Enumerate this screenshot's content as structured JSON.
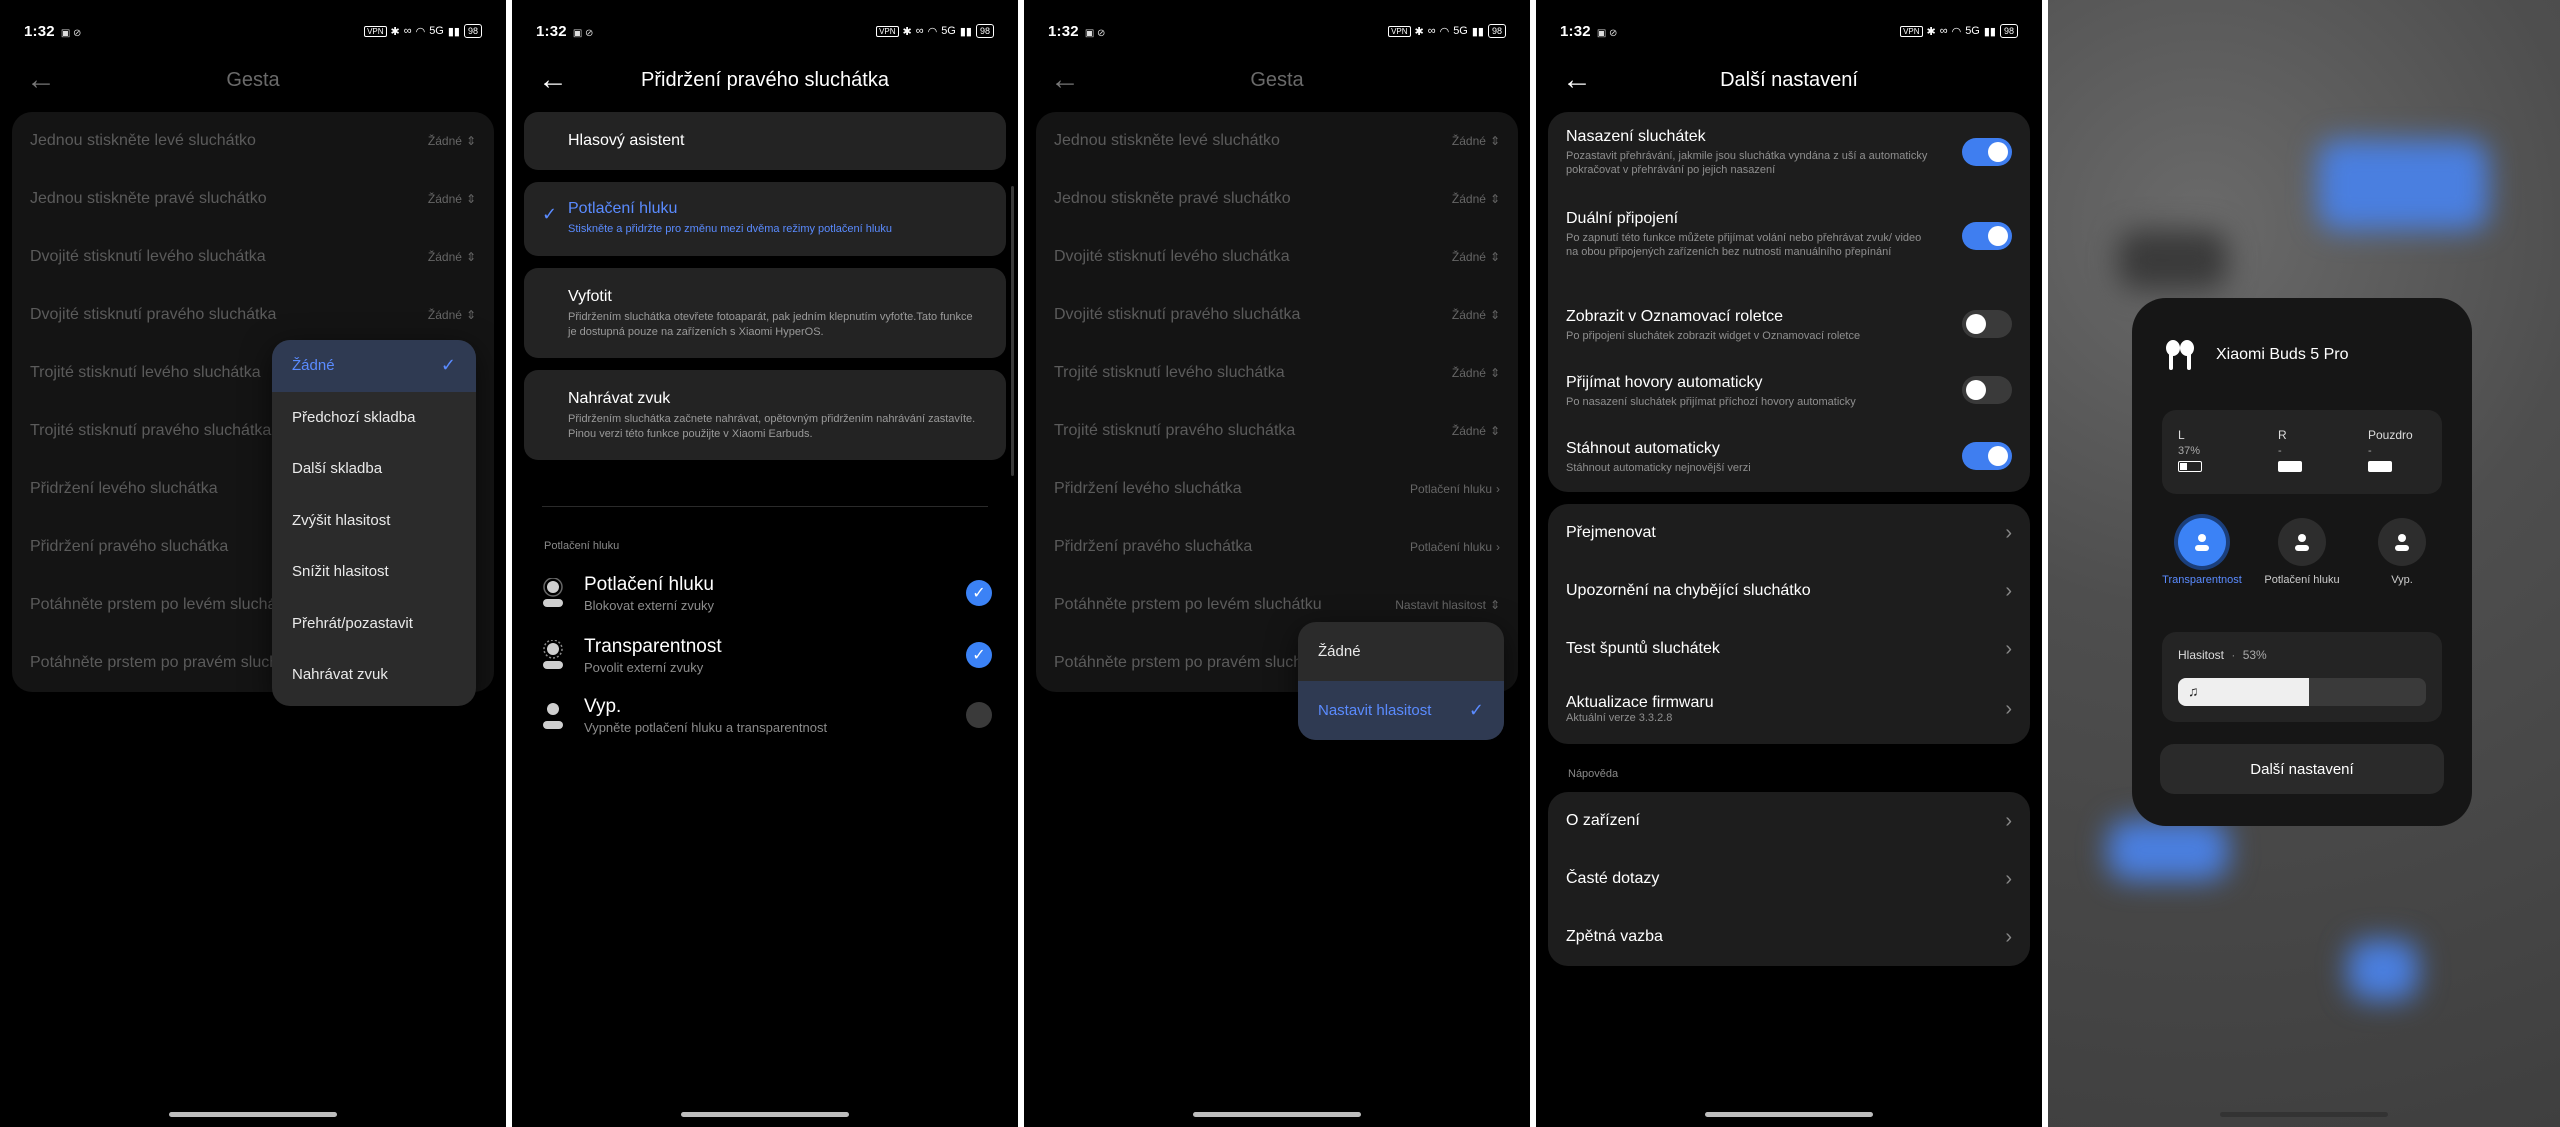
{
  "status": {
    "time": "1:32",
    "battery": "98",
    "vpn": "VPN",
    "network": "5G",
    "network_small": "5G"
  },
  "screen1": {
    "title": "Gesta",
    "rows": [
      {
        "label": "Jednou stiskněte levé sluchátko",
        "value": "Žádné"
      },
      {
        "label": "Jednou stiskněte pravé sluchátko",
        "value": "Žádné"
      },
      {
        "label": "Dvojité stisknutí levého sluchátka",
        "value": "Žádné"
      },
      {
        "label": "Dvojité stisknutí pravého sluchátka",
        "value": "Žádné"
      },
      {
        "label": "Trojité stisknutí levého sluchátka",
        "value": ""
      },
      {
        "label": "Trojité stisknutí pravého sluchátka",
        "value": ""
      },
      {
        "label": "Přidržení levého sluchátka",
        "value": ""
      },
      {
        "label": "Přidržení pravého sluchátka",
        "value": ""
      },
      {
        "label": "Potáhněte prstem po levém sluchátku",
        "value": ""
      },
      {
        "label": "Potáhněte prstem po pravém sluchátku",
        "value": ""
      }
    ],
    "dropdown": [
      "Žádné",
      "Předchozí skladba",
      "Další skladba",
      "Zvýšit hlasitost",
      "Snížit hlasitost",
      "Přehrát/pozastavit",
      "Nahrávat zvuk"
    ],
    "dropdown_selected": 0
  },
  "screen2": {
    "title": "Přidržení pravého sluchátka",
    "options": [
      {
        "title": "Hlasový asistent",
        "desc": ""
      },
      {
        "title": "Potlačení hluku",
        "desc": "Stiskněte a přidržte pro změnu mezi dvěma režimy potlačení hluku"
      },
      {
        "title": "Vyfotit",
        "desc": "Přidržením sluchátka otevřete fotoaparát, pak jedním klepnutím vyfoťte.Tato funkce je dostupná pouze na zařízeních s Xiaomi HyperOS."
      },
      {
        "title": "Nahrávat zvuk",
        "desc": "Přidržením sluchátka začnete nahrávat, opětovným přidržením nahrávání zastavíte. Pinou verzi této funkce použijte v Xiaomi Earbuds."
      }
    ],
    "section": "Potlačení hluku",
    "anc": [
      {
        "title": "Potlačení hluku",
        "desc": "Blokovat externí zvuky",
        "checked": true
      },
      {
        "title": "Transparentnost",
        "desc": "Povolit externí zvuky",
        "checked": true
      },
      {
        "title": "Vyp.",
        "desc": "Vypněte potlačení hluku a transparentnost",
        "checked": false
      }
    ]
  },
  "screen3": {
    "title": "Gesta",
    "rows": [
      {
        "label": "Jednou stiskněte levé sluchátko",
        "value": "Žádné"
      },
      {
        "label": "Jednou stiskněte pravé sluchátko",
        "value": "Žádné"
      },
      {
        "label": "Dvojité stisknutí levého sluchátka",
        "value": "Žádné"
      },
      {
        "label": "Dvojité stisknutí pravého sluchátka",
        "value": "Žádné"
      },
      {
        "label": "Trojité stisknutí levého sluchátka",
        "value": "Žádné"
      },
      {
        "label": "Trojité stisknutí pravého sluchátka",
        "value": "Žádné"
      },
      {
        "label": "Přidržení levého sluchátka",
        "value": "Potlačení hluku"
      },
      {
        "label": "Přidržení pravého sluchátka",
        "value": "Potlačení hluku"
      },
      {
        "label": "Potáhněte prstem po levém sluchátku",
        "value": "Nastavit hlasitost"
      },
      {
        "label": "Potáhněte prstem po pravém sluchátku",
        "value": ""
      }
    ],
    "dropdown": [
      "Žádné",
      "Nastavit hlasitost"
    ],
    "dropdown_selected": 1
  },
  "screen4": {
    "title": "Další nastavení",
    "toggles": [
      {
        "title": "Nasazení sluchátek",
        "desc": "Pozastavit přehrávání, jakmile jsou sluchátka vyndána z uší a automaticky pokračovat v přehrávání po jejich nasazení",
        "on": true
      },
      {
        "title": "Duální připojení",
        "desc": "Po zapnutí této funkce můžete přijímat volání nebo přehrávat zvuk/ video na obou připojených zařízeních bez nutnosti manuálního přepínání",
        "on": true
      },
      {
        "title": "Zobrazit v Oznamovací roletce",
        "desc": "Po připojení sluchátek zobrazit widget v Oznamovací roletce",
        "on": false
      },
      {
        "title": "Přijímat hovory automaticky",
        "desc": "Po nasazení sluchátek přijímat příchozí hovory automaticky",
        "on": false
      },
      {
        "title": "Stáhnout automaticky",
        "desc": "Stáhnout automaticky nejnovější verzi",
        "on": true
      }
    ],
    "links": [
      {
        "title": "Přejmenovat",
        "sub": ""
      },
      {
        "title": "Upozornění na chybějící sluchátko",
        "sub": ""
      },
      {
        "title": "Test špuntů sluchátek",
        "sub": ""
      },
      {
        "title": "Aktualizace firmwaru",
        "sub": "Aktuální verze 3.3.2.8"
      }
    ],
    "help_header": "Nápověda",
    "help": [
      "O zařízení",
      "Časté dotazy",
      "Zpětná vazba"
    ]
  },
  "screen5": {
    "device": "Xiaomi Buds 5 Pro",
    "l_label": "L",
    "l_value": "37%",
    "l_level": 0.37,
    "r_label": "R",
    "r_value": "-",
    "case_label": "Pouzdro",
    "case_value": "-",
    "modes": [
      "Transparentnost",
      "Potlačení hluku",
      "Vyp."
    ],
    "volume_label": "Hlasitost",
    "volume_sep": "·",
    "volume_value": "53%",
    "volume_level": 0.53,
    "more": "Další nastavení"
  }
}
